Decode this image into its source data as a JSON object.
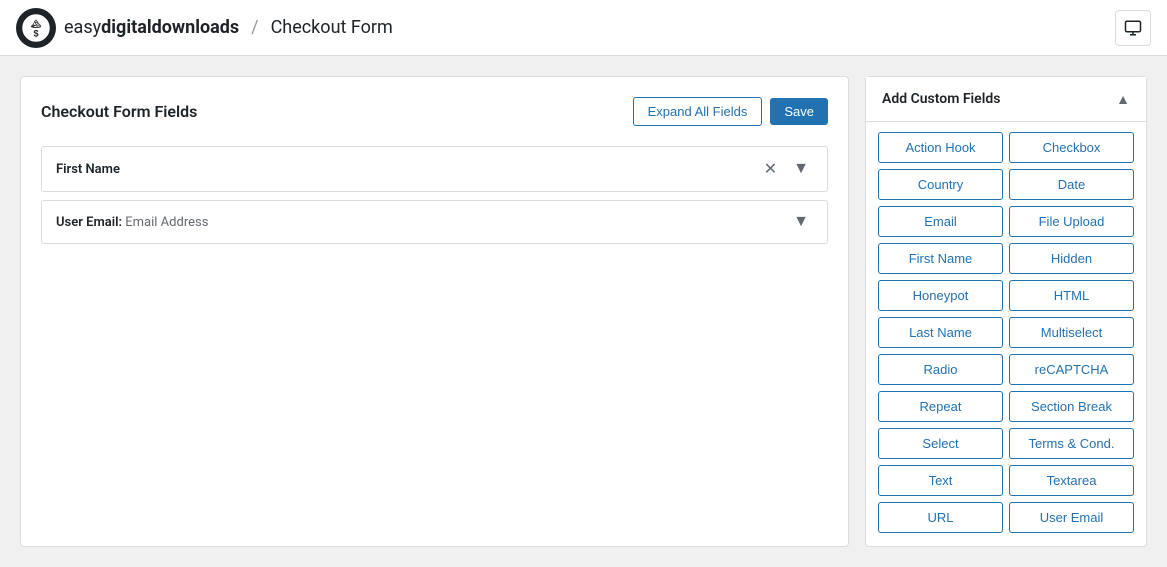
{
  "header": {
    "logo_text_regular": "easy",
    "logo_text_bold": "digitaldownloads",
    "breadcrumb_separator": "/",
    "breadcrumb_page": "Checkout Form",
    "monitor_icon_label": "monitor"
  },
  "form_panel": {
    "title": "Checkout Form Fields",
    "expand_all_label": "Expand All Fields",
    "save_label": "Save",
    "fields": [
      {
        "label": "First Name",
        "sublabel": "",
        "has_remove": true,
        "has_expand": true
      },
      {
        "label": "User Email",
        "sublabel": "Email Address",
        "has_remove": false,
        "has_expand": true
      }
    ]
  },
  "sidebar": {
    "title": "Add Custom Fields",
    "collapse_icon": "▲",
    "field_chips": [
      "Action Hook",
      "Checkbox",
      "Country",
      "Date",
      "Email",
      "File Upload",
      "First Name",
      "Hidden",
      "Honeypot",
      "HTML",
      "Last Name",
      "Multiselect",
      "Radio",
      "reCAPTCHA",
      "Repeat",
      "Section Break",
      "Select",
      "Terms & Cond.",
      "Text",
      "Textarea",
      "URL",
      "User Email"
    ]
  }
}
